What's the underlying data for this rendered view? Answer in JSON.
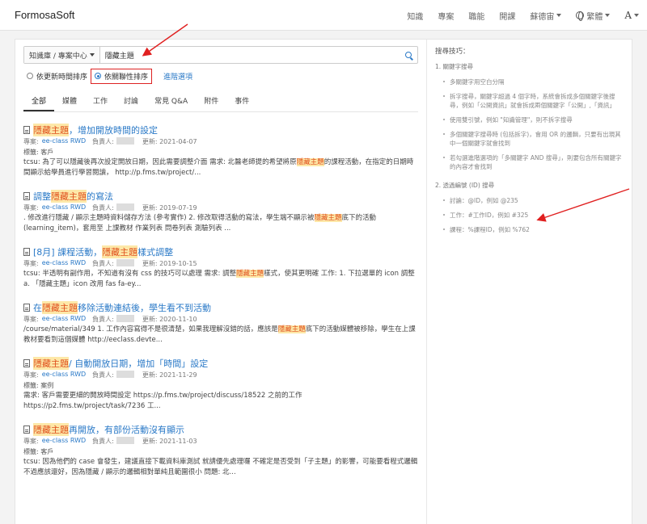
{
  "header": {
    "brand": "FormosaSoft",
    "nav": [
      "知識",
      "專案",
      "職能",
      "開課"
    ],
    "user": "蘇德宙",
    "language": "繁體",
    "font_size_label": "A"
  },
  "search": {
    "scope": "知識庫 / 專案中心",
    "query": "隱藏主題"
  },
  "sort": {
    "by_time": "依更新時間排序",
    "by_relevance": "依關聯性排序",
    "advanced": "進階選項"
  },
  "tabs": [
    "全部",
    "媒體",
    "工作",
    "討論",
    "常見 Q&A",
    "附件",
    "事件"
  ],
  "results": [
    {
      "title_pre": "",
      "title_hl": "隱藏主題",
      "title_post": "，增加開放時間的設定",
      "project_label": "專案:",
      "project": "ee-class RWD",
      "owner_label": "負責人:",
      "updated_label": "更新:",
      "updated": "2021-04-07",
      "tags": "標籤: 客戶",
      "body_pre": "tcsu: 為了可以隱藏後再次設定開放日期，因此需要調整介面 需求: 北醫老師提的希望將原",
      "body_hl": "隱藏主題",
      "body_post": "的課程活動，在指定的日期時間顯示給學員進行學習閱讀， http://p.fms.tw/project/..."
    },
    {
      "title_pre": "調整",
      "title_hl": "隱藏主題",
      "title_post": "的寫法",
      "project_label": "專案:",
      "project": "ee-class RWD",
      "owner_label": "負責人:",
      "updated_label": "更新:",
      "updated": "2019-07-19",
      "tags": "",
      "body_pre": ". 修改進行隱藏 / 顯示主題時資料儲存方法 (參考實作) 2. 修改取得活動的寫法，學生端不顯示被",
      "body_hl": "隱藏主題",
      "body_post": "底下的活動(learning_item)，套用至 上課教材 作業列表 問卷列表 測驗列表 ..."
    },
    {
      "title_pre": "[8月] 課程活動，",
      "title_hl": "隱藏主題",
      "title_post": "樣式調整",
      "project_label": "專案:",
      "project": "ee-class RWD",
      "owner_label": "負責人:",
      "updated_label": "更新:",
      "updated": "2019-10-15",
      "tags": "",
      "body_pre": "tcsu: 半透明有副作用，不知道有沒有 css 的技巧可以處理 需求: 調整",
      "body_hl": "隱藏主題",
      "body_post": "樣式，使其更明確 工作: 1. 下拉選單的 icon 調整 a. 「隱藏主題」icon 改用 fas fa-ey..."
    },
    {
      "title_pre": "在",
      "title_hl": "隱藏主題",
      "title_post": "移除活動連結後，學生看不到活動",
      "project_label": "專案:",
      "project": "ee-class RWD",
      "owner_label": "負責人:",
      "updated_label": "更新:",
      "updated": "2020-11-10",
      "tags": "",
      "body_pre": "/course/material/349 1. 工作內容寫得不是很清楚，如果我理解沒錯的話，應該是",
      "body_hl": "隱藏主題",
      "body_post": "底下的活動媒體被移除，學生在上課教材要看到這個媒體 http://eeclass.devte..."
    },
    {
      "title_pre": "",
      "title_hl": "隱藏主題",
      "title_post": " / 自動開放日期，增加「時間」設定",
      "project_label": "專案:",
      "project": "ee-class RWD",
      "owner_label": "負責人:",
      "updated_label": "更新:",
      "updated": "2021-11-29",
      "tags": "標籤: 案例",
      "body_pre": "需求: 客戶需要更細的開放時間設定 https://p.fms.tw/project/discuss/18522 之前的工作 https://p2.fms.tw/project/task/7236 工...",
      "body_hl": "",
      "body_post": ""
    },
    {
      "title_pre": "",
      "title_hl": "隱藏主題",
      "title_post": "再開放，有部份活動沒有顯示",
      "project_label": "專案:",
      "project": "ee-class RWD",
      "owner_label": "負責人:",
      "updated_label": "更新:",
      "updated": "2021-11-03",
      "tags": "標籤: 客戶",
      "body_pre": "tcsu: 因為他們的 case 會發生，建議直接下載資料庫測試 就請優先處理囉 不確定是否受到「子主題」的影響，可能要看程式邏輯 不過應該還好，因為隱藏 / 顯示的邏輯相對單純且範圍很小 問題: 北...",
      "body_hl": "",
      "body_post": ""
    }
  ],
  "tips": {
    "title": "搜尋技巧：",
    "sections": [
      {
        "heading": "1. 關鍵字搜尋",
        "items": [
          "多關鍵字用空白分隔",
          "拆字搜尋，關鍵字超過 4 個字時，系統會拆成多個關鍵字後搜尋，例如「公開資訊」就會拆成兩個關鍵字「公開」,「資訊」",
          "使用雙引號，例如 \"知識管理\"，則不拆字搜尋",
          "多個關鍵字搜尋時 (包括拆字)，會用 OR 的邏輯，只要有出現其中一個關鍵字就會找到",
          "若勾選進階選項的「多關鍵字 AND 搜尋」，則要包含所有關鍵字的內容才會找到"
        ]
      },
      {
        "heading": "2. 透過編號 (ID) 搜尋",
        "items": [
          "討論：@ID，例如 @235",
          "工作：#工作ID，例如 #325",
          "課程：%課程ID，例如 %762"
        ]
      }
    ]
  },
  "annotation_color": "#e02020"
}
